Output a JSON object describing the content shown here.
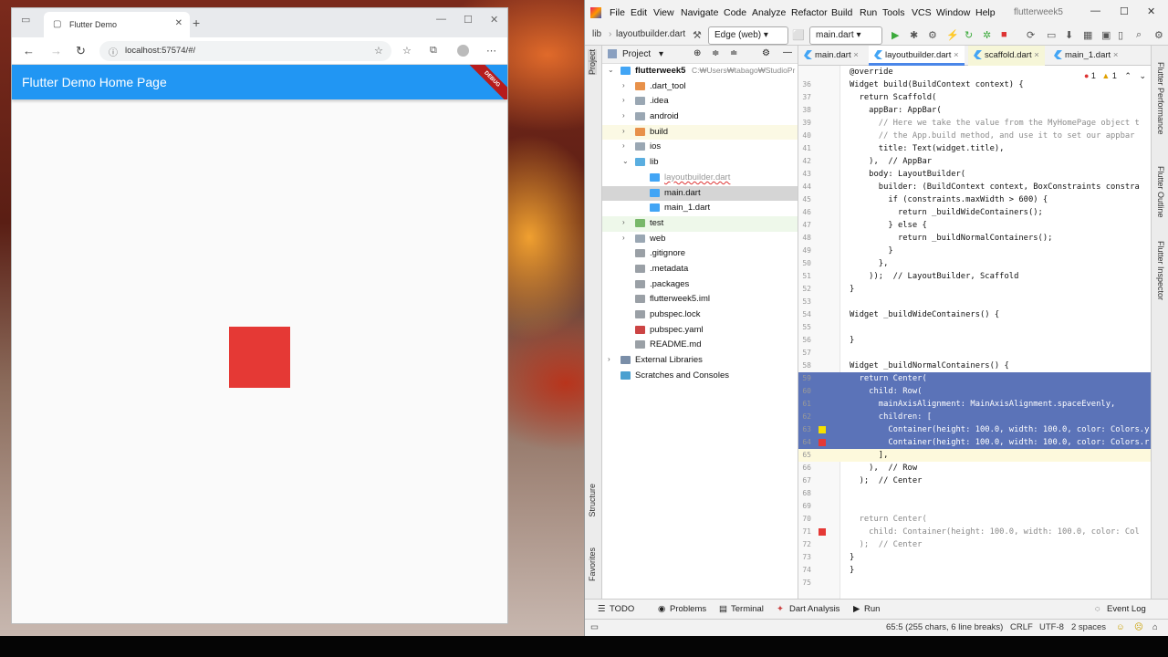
{
  "browser": {
    "tab_title": "Flutter Demo",
    "tab_favicon": "page-icon",
    "url": "localhost:57574/#/",
    "appbar_title": "Flutter Demo Home Page",
    "debug_banner": "DEBUG",
    "box_color": "#e53935",
    "appbar_color": "#2196f3"
  },
  "ide": {
    "menu": [
      "File",
      "Edit",
      "View",
      "Navigate",
      "Code",
      "Analyze",
      "Refactor",
      "Build",
      "Run",
      "Tools",
      "VCS",
      "Window",
      "Help"
    ],
    "project_title": "flutterweek5",
    "toolbar": {
      "breadcrumb_root": "lib",
      "breadcrumb_file": "layoutbuilder.dart",
      "device": "Edge (web)",
      "run_config": "main.dart"
    },
    "left_strip": [
      "Project",
      "Structure",
      "Favorites"
    ],
    "right_strip": [
      "Flutter Performance",
      "Flutter Outline",
      "Flutter Inspector"
    ],
    "project_panel": {
      "header": "Project",
      "root_name": "flutterweek5",
      "root_path": "C:₩Users₩tabago₩StudioPr",
      "items": [
        {
          "label": ".dart_tool",
          "depth": 1,
          "arrow": "›",
          "kind": "folder-orange"
        },
        {
          "label": ".idea",
          "depth": 1,
          "arrow": "›",
          "kind": "folder"
        },
        {
          "label": "android",
          "depth": 1,
          "arrow": "›",
          "kind": "folder"
        },
        {
          "label": "build",
          "depth": 1,
          "arrow": "›",
          "kind": "folder-orange"
        },
        {
          "label": "ios",
          "depth": 1,
          "arrow": "›",
          "kind": "folder"
        },
        {
          "label": "lib",
          "depth": 1,
          "arrow": "⌄",
          "kind": "folder-blue"
        },
        {
          "label": "layoutbuilder.dart",
          "depth": 2,
          "arrow": "",
          "kind": "dart"
        },
        {
          "label": "main.dart",
          "depth": 2,
          "arrow": "",
          "kind": "dart"
        },
        {
          "label": "main_1.dart",
          "depth": 2,
          "arrow": "",
          "kind": "dart"
        },
        {
          "label": "test",
          "depth": 1,
          "arrow": "›",
          "kind": "folder-green"
        },
        {
          "label": "web",
          "depth": 1,
          "arrow": "›",
          "kind": "folder"
        },
        {
          "label": ".gitignore",
          "depth": 1,
          "arrow": "",
          "kind": "file"
        },
        {
          "label": ".metadata",
          "depth": 1,
          "arrow": "",
          "kind": "file"
        },
        {
          "label": ".packages",
          "depth": 1,
          "arrow": "",
          "kind": "file"
        },
        {
          "label": "flutterweek5.iml",
          "depth": 1,
          "arrow": "",
          "kind": "file"
        },
        {
          "label": "pubspec.lock",
          "depth": 1,
          "arrow": "",
          "kind": "file"
        },
        {
          "label": "pubspec.yaml",
          "depth": 1,
          "arrow": "",
          "kind": "yaml"
        },
        {
          "label": "README.md",
          "depth": 1,
          "arrow": "",
          "kind": "file"
        },
        {
          "label": "External Libraries",
          "depth": 0,
          "arrow": "›",
          "kind": "lib"
        },
        {
          "label": "Scratches and Consoles",
          "depth": 0,
          "arrow": "",
          "kind": "scratch"
        }
      ]
    },
    "editor_tabs": [
      "main.dart",
      "layoutbuilder.dart",
      "scaffold.dart",
      "main_1.dart"
    ],
    "inspections": {
      "errors": "1",
      "warnings": "1"
    },
    "code_lines": [
      {
        "n": "",
        "t": "@override"
      },
      {
        "n": "36",
        "t": "Widget build(BuildContext context) {"
      },
      {
        "n": "37",
        "t": "  return Scaffold("
      },
      {
        "n": "38",
        "t": "    appBar: AppBar("
      },
      {
        "n": "39",
        "t": "      // Here we take the value from the MyHomePage object t"
      },
      {
        "n": "40",
        "t": "      // the App.build method, and use it to set our appbar"
      },
      {
        "n": "41",
        "t": "      title: Text(widget.title),"
      },
      {
        "n": "42",
        "t": "    ),  // AppBar"
      },
      {
        "n": "43",
        "t": "    body: LayoutBuilder("
      },
      {
        "n": "44",
        "t": "      builder: (BuildContext context, BoxConstraints constra"
      },
      {
        "n": "45",
        "t": "        if (constraints.maxWidth > 600) {"
      },
      {
        "n": "46",
        "t": "          return _buildWideContainers();"
      },
      {
        "n": "47",
        "t": "        } else {"
      },
      {
        "n": "48",
        "t": "          return _buildNormalContainers();"
      },
      {
        "n": "49",
        "t": "        }"
      },
      {
        "n": "50",
        "t": "      },"
      },
      {
        "n": "51",
        "t": "    ));  // LayoutBuilder, Scaffold"
      },
      {
        "n": "52",
        "t": "}"
      },
      {
        "n": "53",
        "t": ""
      },
      {
        "n": "54",
        "t": "Widget _buildWideContainers() {"
      },
      {
        "n": "55",
        "t": ""
      },
      {
        "n": "56",
        "t": "}"
      },
      {
        "n": "57",
        "t": ""
      },
      {
        "n": "58",
        "t": "Widget _buildNormalContainers() {"
      },
      {
        "n": "59",
        "t": "  return Center("
      },
      {
        "n": "60",
        "t": "    child: Row("
      },
      {
        "n": "61",
        "t": "      mainAxisAlignment: MainAxisAlignment.spaceEvenly,"
      },
      {
        "n": "62",
        "t": "      children: ["
      },
      {
        "n": "63",
        "t": "        Container(height: 100.0, width: 100.0, color: Colors.y"
      },
      {
        "n": "64",
        "t": "        Container(height: 100.0, width: 100.0, color: Colors.r"
      },
      {
        "n": "65",
        "t": "      ],"
      },
      {
        "n": "66",
        "t": "    ),  // Row"
      },
      {
        "n": "67",
        "t": "  );  // Center"
      },
      {
        "n": "68",
        "t": ""
      },
      {
        "n": "69",
        "t": ""
      },
      {
        "n": "70",
        "t": "  return Center("
      },
      {
        "n": "71",
        "t": "    child: Container(height: 100.0, width: 100.0, color: Col"
      },
      {
        "n": "72",
        "t": "  );  // Center"
      },
      {
        "n": "73",
        "t": "}"
      },
      {
        "n": "74",
        "t": "}"
      },
      {
        "n": "75",
        "t": ""
      }
    ],
    "bottom_tabs": [
      "TODO",
      "Problems",
      "Terminal",
      "Dart Analysis",
      "Run"
    ],
    "event_log": "Event Log",
    "status": {
      "position": "65:5 (255 chars, 6 line breaks)",
      "line_sep": "CRLF",
      "encoding": "UTF-8",
      "indent": "2 spaces"
    },
    "selection_color": "#5b73b8"
  }
}
